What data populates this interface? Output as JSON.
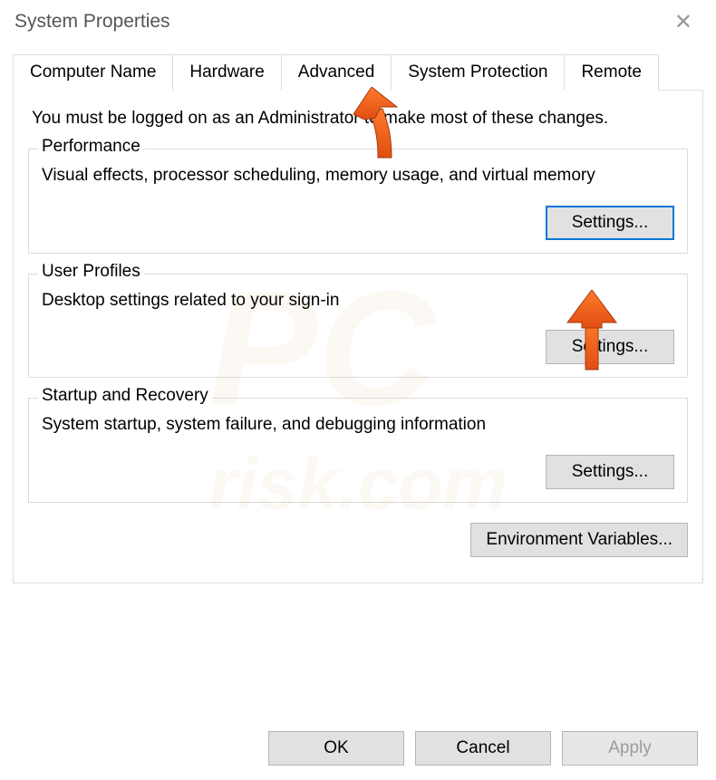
{
  "window": {
    "title": "System Properties"
  },
  "tabs": {
    "computer_name": "Computer Name",
    "hardware": "Hardware",
    "advanced": "Advanced",
    "system_protection": "System Protection",
    "remote": "Remote"
  },
  "content": {
    "intro": "You must be logged on as an Administrator to make most of these changes.",
    "performance": {
      "legend": "Performance",
      "desc": "Visual effects, processor scheduling, memory usage, and virtual memory",
      "button": "Settings..."
    },
    "user_profiles": {
      "legend": "User Profiles",
      "desc": "Desktop settings related to your sign-in",
      "button": "Settings..."
    },
    "startup_recovery": {
      "legend": "Startup and Recovery",
      "desc": "System startup, system failure, and debugging information",
      "button": "Settings..."
    },
    "env_vars_button": "Environment Variables..."
  },
  "buttons": {
    "ok": "OK",
    "cancel": "Cancel",
    "apply": "Apply"
  },
  "watermark": {
    "main": "PC",
    "sub": "risk.com"
  }
}
